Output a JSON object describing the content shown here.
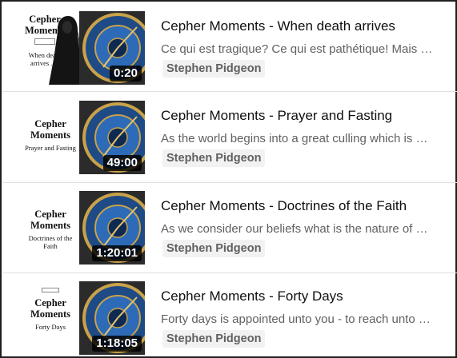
{
  "videos": [
    {
      "title": "Cepher Moments - When death arrives",
      "description": "Ce qui est tragique? Ce qui est pathétique! Mais en ce temps-là",
      "channel": "Stephen Pidgeon",
      "duration": "0:20",
      "thumb_title": "Cepher Moments",
      "thumb_subtitle": "When death arrives . . ."
    },
    {
      "title": "Cepher Moments - Prayer and Fasting",
      "description": "As the world begins into a great culling which is upon us",
      "channel": "Stephen Pidgeon",
      "duration": "49:00",
      "thumb_title": "Cepher Moments",
      "thumb_subtitle": "Prayer and Fasting"
    },
    {
      "title": "Cepher Moments - Doctrines of the Faith",
      "description": "As we consider our beliefs what is the nature of our faith",
      "channel": "Stephen Pidgeon",
      "duration": "1:20:01",
      "thumb_title": "Cepher Moments",
      "thumb_subtitle": "Doctrines of the Faith"
    },
    {
      "title": "Cepher Moments - Forty Days",
      "description": "Forty days is appointed unto you - to reach unto the end",
      "channel": "Stephen Pidgeon",
      "duration": "1:18:05",
      "thumb_title": "Cepher Moments",
      "thumb_subtitle": "Forty Days"
    }
  ],
  "colors": {
    "title": "#0f0f0f",
    "description": "#606060",
    "channel_bg": "#f2f2f2",
    "duration_bg": "#000000",
    "clock_blue": "#1e4a86",
    "clock_gold": "#c9a24a"
  },
  "icons": {
    "clock": "astronomical-clock-icon",
    "reaper": "grim-reaper-icon"
  }
}
